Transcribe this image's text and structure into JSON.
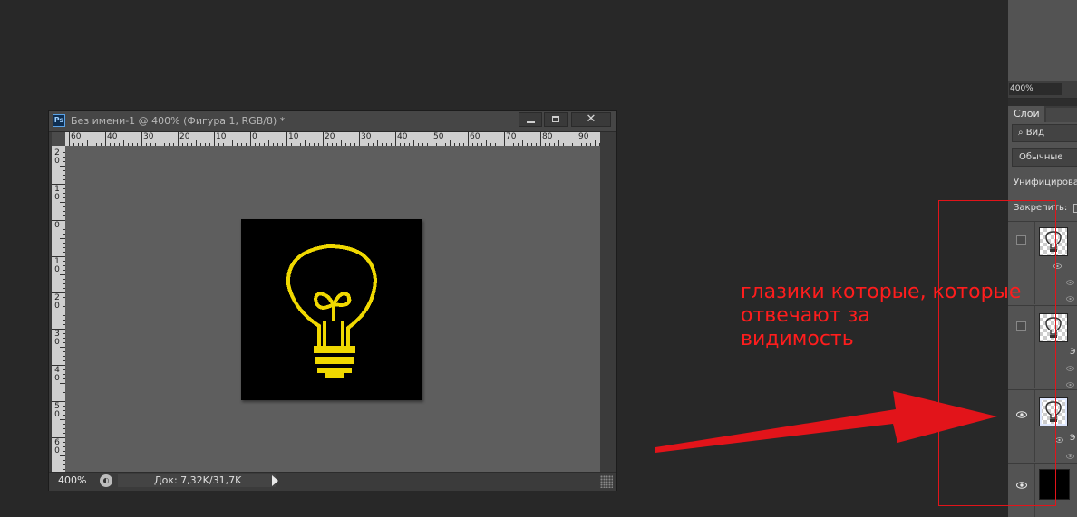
{
  "document": {
    "app_icon": "Ps",
    "title": "Без имени-1 @ 400% (Фигура 1, RGB/8) *",
    "close_glyph": "✕",
    "ruler_h_labels": [
      "60",
      "40",
      "30",
      "20",
      "10",
      "0",
      "10",
      "20",
      "30",
      "40",
      "50",
      "60",
      "70",
      "80",
      "90"
    ],
    "ruler_v_labels": [
      "2\n0",
      "1\n0",
      "0",
      "1\n0",
      "2\n0",
      "3\n0",
      "4\n0",
      "5\n0",
      "6\n0"
    ],
    "zoom": "400%",
    "doc_size": "Док: 7,32K/31,7K"
  },
  "layers_panel": {
    "zoom_field": "400%",
    "tab_label": "Слои",
    "filter_label": "Вид",
    "blend_mode": "Обычные",
    "unify_label": "Унифицирова",
    "lock_label": "Закрепить:",
    "layers": [
      {
        "visible": false,
        "effect_letter": ""
      },
      {
        "visible": false,
        "effect_letter": "Э"
      },
      {
        "visible": true,
        "effect_letter": "Э",
        "selected": true
      },
      {
        "visible": true,
        "effect_letter": ""
      }
    ]
  },
  "annotation": {
    "text_lines": [
      "глазики которые, которые",
      "отвечают за",
      "видимость"
    ],
    "color": "#e2141a"
  },
  "colors": {
    "bulb": "#f0d800",
    "annotation_red": "#e2141a"
  }
}
